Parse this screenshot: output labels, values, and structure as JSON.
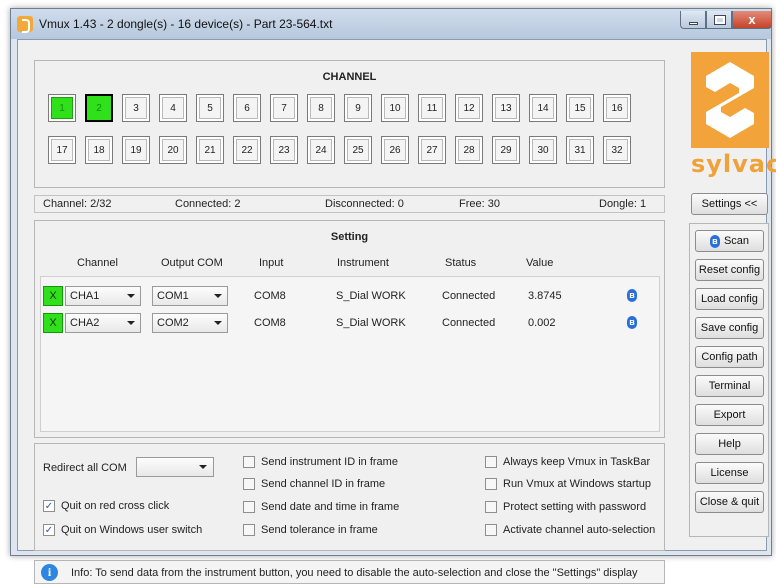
{
  "window": {
    "title": "Vmux 1.43 - 2 dongle(s) - 16 device(s) - Part 23-564.txt",
    "close_glyph": "x"
  },
  "channel": {
    "title": "CHANNEL",
    "row1": [
      "1",
      "2",
      "3",
      "4",
      "5",
      "6",
      "7",
      "8",
      "9",
      "10",
      "11",
      "12",
      "13",
      "14",
      "15",
      "16"
    ],
    "row2": [
      "17",
      "18",
      "19",
      "20",
      "21",
      "22",
      "23",
      "24",
      "25",
      "26",
      "27",
      "28",
      "29",
      "30",
      "31",
      "32"
    ],
    "active": [
      "1",
      "2"
    ],
    "selected": "2",
    "active_color": "#2fe01a"
  },
  "logo": {
    "text": "sylvac",
    "color": "#f2a43a"
  },
  "status": {
    "channel": "Channel: 2/32",
    "connected": "Connected: 2",
    "disconnected": "Disconnected: 0",
    "free": "Free: 30",
    "dongle": "Dongle: 1"
  },
  "settings_button": "Settings <<",
  "setting": {
    "title": "Setting",
    "headers": {
      "channel": "Channel",
      "output_com": "Output COM",
      "input": "Input",
      "instrument": "Instrument",
      "status": "Status",
      "value": "Value"
    },
    "rows": [
      {
        "x": "X",
        "channel": "CHA1",
        "output": "COM1",
        "input": "COM8",
        "instrument": "S_Dial WORK",
        "status": "Connected",
        "value": "3.8745",
        "icon": "bluetooth-icon"
      },
      {
        "x": "X",
        "channel": "CHA2",
        "output": "COM2",
        "input": "COM8",
        "instrument": "S_Dial WORK",
        "status": "Connected",
        "value": "0.002",
        "icon": "bluetooth-icon"
      }
    ]
  },
  "options": {
    "redirect_label": "Redirect all COM",
    "redirect_value": "",
    "quit_red_cross": "Quit on red cross click",
    "quit_user_switch": "Quit on Windows user switch",
    "send_instrument_id": "Send instrument ID in frame",
    "send_channel_id": "Send channel ID in frame",
    "send_date_time": "Send date and time in frame",
    "send_tolerance": "Send tolerance in frame",
    "keep_taskbar": "Always keep Vmux in TaskBar",
    "run_startup": "Run Vmux at Windows startup",
    "protect_password": "Protect setting with password",
    "auto_selection": "Activate channel auto-selection"
  },
  "side_buttons": {
    "scan": "Scan",
    "reset": "Reset config",
    "load": "Load config",
    "save": "Save config",
    "path": "Config path",
    "terminal": "Terminal",
    "export": "Export",
    "help": "Help",
    "license": "License",
    "close": "Close & quit"
  },
  "info": {
    "text": "Info: To send data from the instrument button, you need to disable the auto-selection and close the \"Settings\" display"
  }
}
